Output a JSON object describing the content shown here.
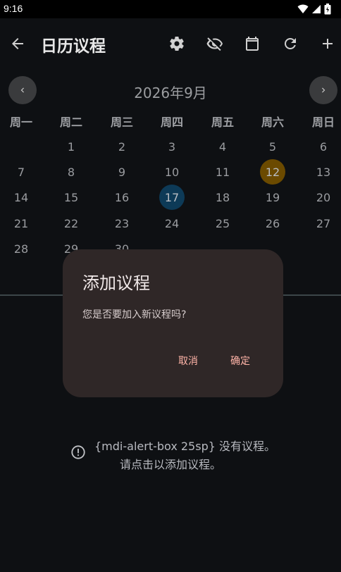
{
  "status_bar": {
    "time": "9:16",
    "icons": [
      "wifi-icon",
      "signal-icon",
      "battery-icon"
    ]
  },
  "app_bar": {
    "title": "日历议程",
    "actions": [
      "settings-icon",
      "visibility-off-icon",
      "calendar-icon",
      "refresh-icon",
      "add-icon"
    ]
  },
  "calendar": {
    "month_title": "2026年9月",
    "weekdays": [
      "周一",
      "周二",
      "周三",
      "周四",
      "周五",
      "周六",
      "周日"
    ],
    "weeks": [
      [
        "",
        "1",
        "2",
        "3",
        "4",
        "5",
        "6"
      ],
      [
        "7",
        "8",
        "9",
        "10",
        "11",
        "12",
        "13"
      ],
      [
        "14",
        "15",
        "16",
        "17",
        "18",
        "19",
        "20"
      ],
      [
        "21",
        "22",
        "23",
        "24",
        "25",
        "26",
        "27"
      ],
      [
        "28",
        "29",
        "30",
        "",
        "",
        "",
        ""
      ]
    ],
    "selected_day": "12",
    "today_day": "17",
    "selected_color": "#6b4a00",
    "today_color": "#0d3a57"
  },
  "dialog": {
    "title": "添加议程",
    "message": "您是否要加入新议程吗?",
    "cancel_label": "取消",
    "confirm_label": "确定"
  },
  "empty_state": {
    "line1": "{mdi-alert-box 25sp} 没有议程。",
    "line2": "请点击以添加议程。",
    "icon": "alert-circle-icon"
  }
}
